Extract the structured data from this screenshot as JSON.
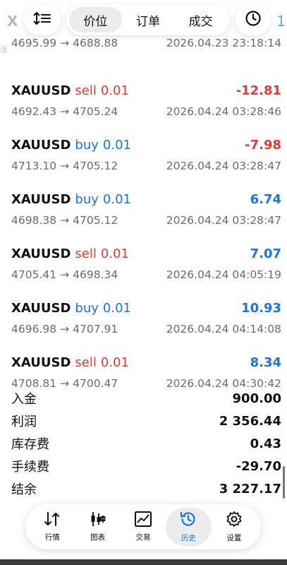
{
  "header": {
    "ghost_title": "X",
    "ghost_count": "1",
    "tabs": [
      {
        "label": "价位",
        "active": true
      },
      {
        "label": "订单",
        "active": false
      },
      {
        "label": "成交",
        "active": false
      }
    ]
  },
  "deals": [
    {
      "symbol": "",
      "direction": "",
      "volume": "",
      "profit": "",
      "open_price": "4695.99",
      "close_price": "4688.88",
      "time": "2026.04.23 23:18:14"
    },
    {
      "symbol": "XAUUSD",
      "direction": "sell",
      "volume": "0.01",
      "profit": "-12.81",
      "open_price": "4692.43",
      "close_price": "4705.24",
      "time": "2026.04.24 03:28:46"
    },
    {
      "symbol": "XAUUSD",
      "direction": "buy",
      "volume": "0.01",
      "profit": "-7.98",
      "open_price": "4713.10",
      "close_price": "4705.12",
      "time": "2026.04.24 03:28:47"
    },
    {
      "symbol": "XAUUSD",
      "direction": "buy",
      "volume": "0.01",
      "profit": "6.74",
      "open_price": "4698.38",
      "close_price": "4705.12",
      "time": "2026.04.24 03:28:47"
    },
    {
      "symbol": "XAUUSD",
      "direction": "sell",
      "volume": "0.01",
      "profit": "7.07",
      "open_price": "4705.41",
      "close_price": "4698.34",
      "time": "2026.04.24 04:05:19"
    },
    {
      "symbol": "XAUUSD",
      "direction": "buy",
      "volume": "0.01",
      "profit": "10.93",
      "open_price": "4696.98",
      "close_price": "4707.91",
      "time": "2026.04.24 04:14:08"
    },
    {
      "symbol": "XAUUSD",
      "direction": "sell",
      "volume": "0.01",
      "profit": "8.34",
      "open_price": "4708.81",
      "close_price": "4700.47",
      "time": "2026.04.24 04:30:42"
    }
  ],
  "arrow": "→",
  "summary": [
    {
      "label": "入金",
      "value": "900.00"
    },
    {
      "label": "利润",
      "value": "2 356.44"
    },
    {
      "label": "库存费",
      "value": "0.43"
    },
    {
      "label": "手续费",
      "value": "-29.70"
    },
    {
      "label": "结余",
      "value": "3 227.17"
    }
  ],
  "nav": [
    {
      "label": "行情",
      "icon": "quotes-icon",
      "active": false
    },
    {
      "label": "图表",
      "icon": "chart-icon",
      "active": false
    },
    {
      "label": "交易",
      "icon": "trade-icon",
      "active": false
    },
    {
      "label": "历史",
      "icon": "history-icon",
      "active": true
    },
    {
      "label": "设置",
      "icon": "settings-icon",
      "active": false
    }
  ],
  "colors": {
    "sell": "#e53935",
    "buy": "#1a73e8",
    "profit_negative": "#e53935",
    "profit_positive": "#1a73e8",
    "active_nav": "#1a73e8"
  }
}
